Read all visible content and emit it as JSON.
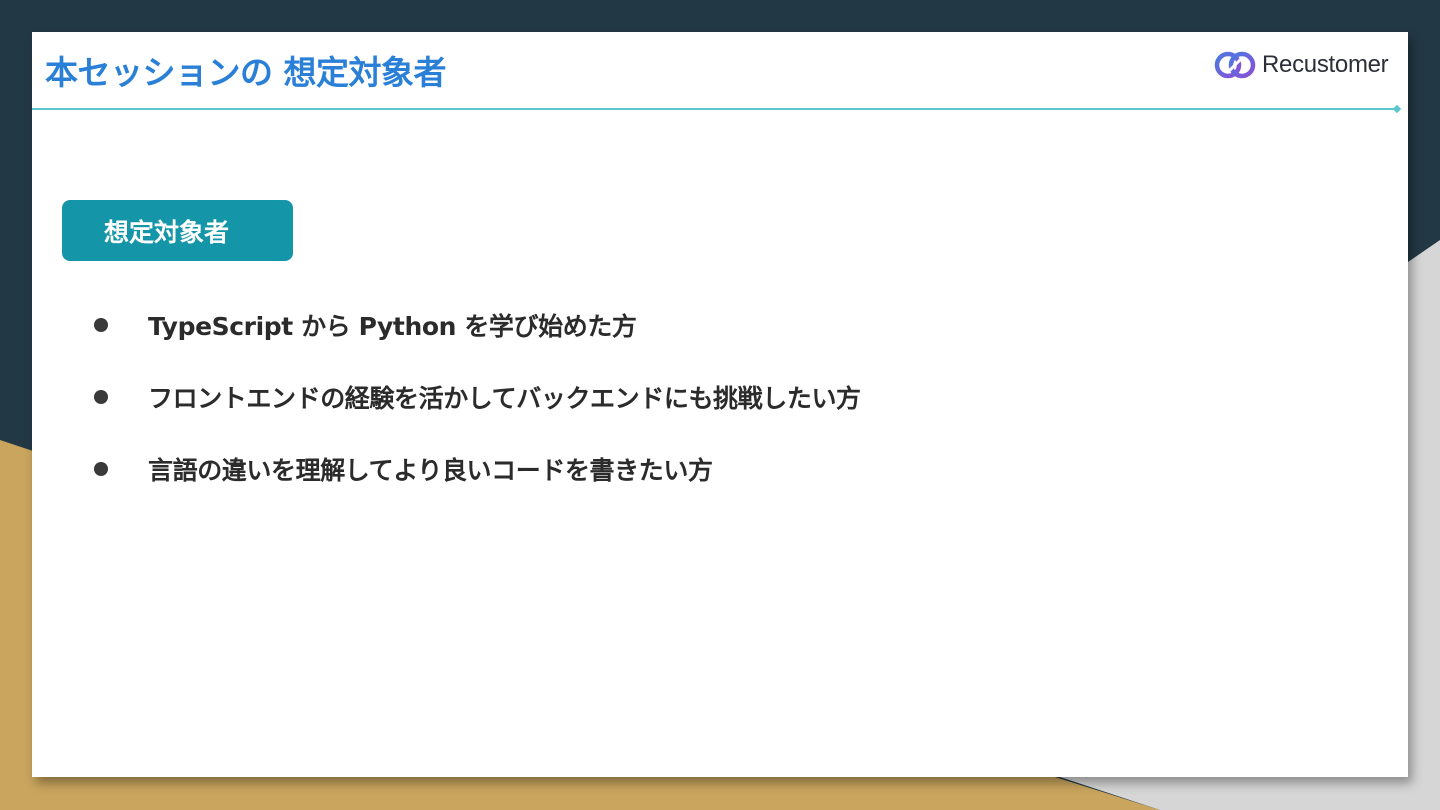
{
  "slide": {
    "title": "本セッションの 想定対象者",
    "logo_text": "Recustomer",
    "badge_label": "想定対象者",
    "bullets": [
      "TypeScript から Python を学び始めた方",
      "フロントエンドの経験を活かしてバックエンドにも挑戦したい方",
      "言語の違いを理解してより良いコードを書きたい方"
    ]
  },
  "colors": {
    "background_dark": "#233845",
    "background_gold": "#c9a55e",
    "background_gray": "#d6d6d6",
    "title_blue": "#2a7fd6",
    "divider_teal": "#5bc8cf",
    "badge_teal": "#1596a8",
    "text_dark": "#2b2b2b"
  },
  "icons": {
    "logo": "recustomer-logo-icon",
    "bullet": "bullet-dot-icon"
  }
}
